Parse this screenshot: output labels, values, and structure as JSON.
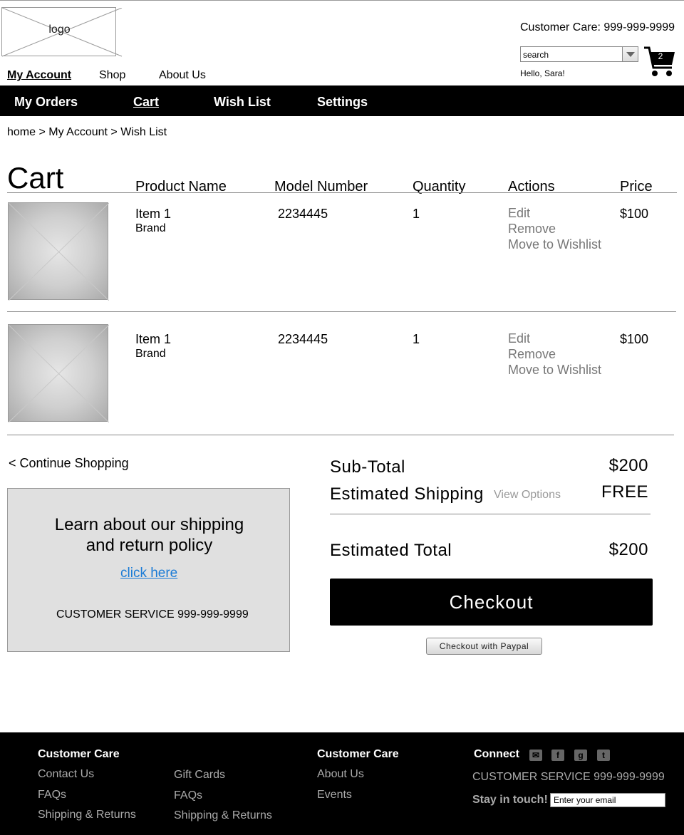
{
  "header": {
    "logo_text": "logo",
    "customer_care": "Customer Care: 999-999-9999",
    "search_placeholder": "search",
    "greeting": "Hello, Sara!",
    "cart_count": "2",
    "nav": [
      {
        "label": "My Account",
        "active": true
      },
      {
        "label": "Shop",
        "active": false
      },
      {
        "label": "About Us",
        "active": false
      }
    ]
  },
  "subnav": [
    {
      "label": "My Orders",
      "active": false
    },
    {
      "label": "Cart",
      "active": true
    },
    {
      "label": "Wish List",
      "active": false
    },
    {
      "label": "Settings",
      "active": false
    }
  ],
  "breadcrumb": "home > My Account > Wish List",
  "cart": {
    "title": "Cart",
    "columns": [
      "Product Name",
      "Model Number",
      "Quantity",
      "Actions",
      "Price"
    ],
    "items": [
      {
        "name": "Item 1",
        "brand": "Brand",
        "model": "2234445",
        "quantity": "1",
        "actions": [
          "Edit",
          "Remove",
          "Move to Wishlist"
        ],
        "price": "$100"
      },
      {
        "name": "Item 1",
        "brand": "Brand",
        "model": "2234445",
        "quantity": "1",
        "actions": [
          "Edit",
          "Remove",
          "Move to Wishlist"
        ],
        "price": "$100"
      }
    ]
  },
  "continue_shopping": "< Continue Shopping",
  "policy": {
    "title_line1": "Learn about our shipping",
    "title_line2": "and return policy",
    "link": "click here",
    "customer_service": "CUSTOMER SERVICE 999-999-9999"
  },
  "summary": {
    "subtotal_label": "Sub-Total",
    "subtotal_value": "$200",
    "shipping_label": "Estimated Shipping",
    "shipping_options": "View Options",
    "shipping_value": "FREE",
    "total_label": "Estimated Total",
    "total_value": "$200",
    "checkout": "Checkout",
    "paypal": "Checkout with Paypal"
  },
  "footer": {
    "col1_heading": "Customer Care",
    "col1_links": [
      "Contact Us",
      "FAQs",
      "Shipping & Returns"
    ],
    "col2_links": [
      "Gift Cards",
      "FAQs",
      "Shipping & Returns"
    ],
    "col3_heading": "Customer Care",
    "col3_links": [
      "About Us",
      "Events"
    ],
    "connect_heading": "Connect",
    "social_icons": [
      "mail-icon",
      "facebook-icon",
      "google-icon",
      "twitter-icon"
    ],
    "customer_service": "CUSTOMER SERVICE 999-999-9999",
    "stay_label": "Stay in touch!",
    "email_placeholder": "Enter your email"
  },
  "colors": {
    "bar": "#000000",
    "link": "#1a7bd6",
    "muted": "#777777",
    "panel": "#e0e0e0"
  }
}
